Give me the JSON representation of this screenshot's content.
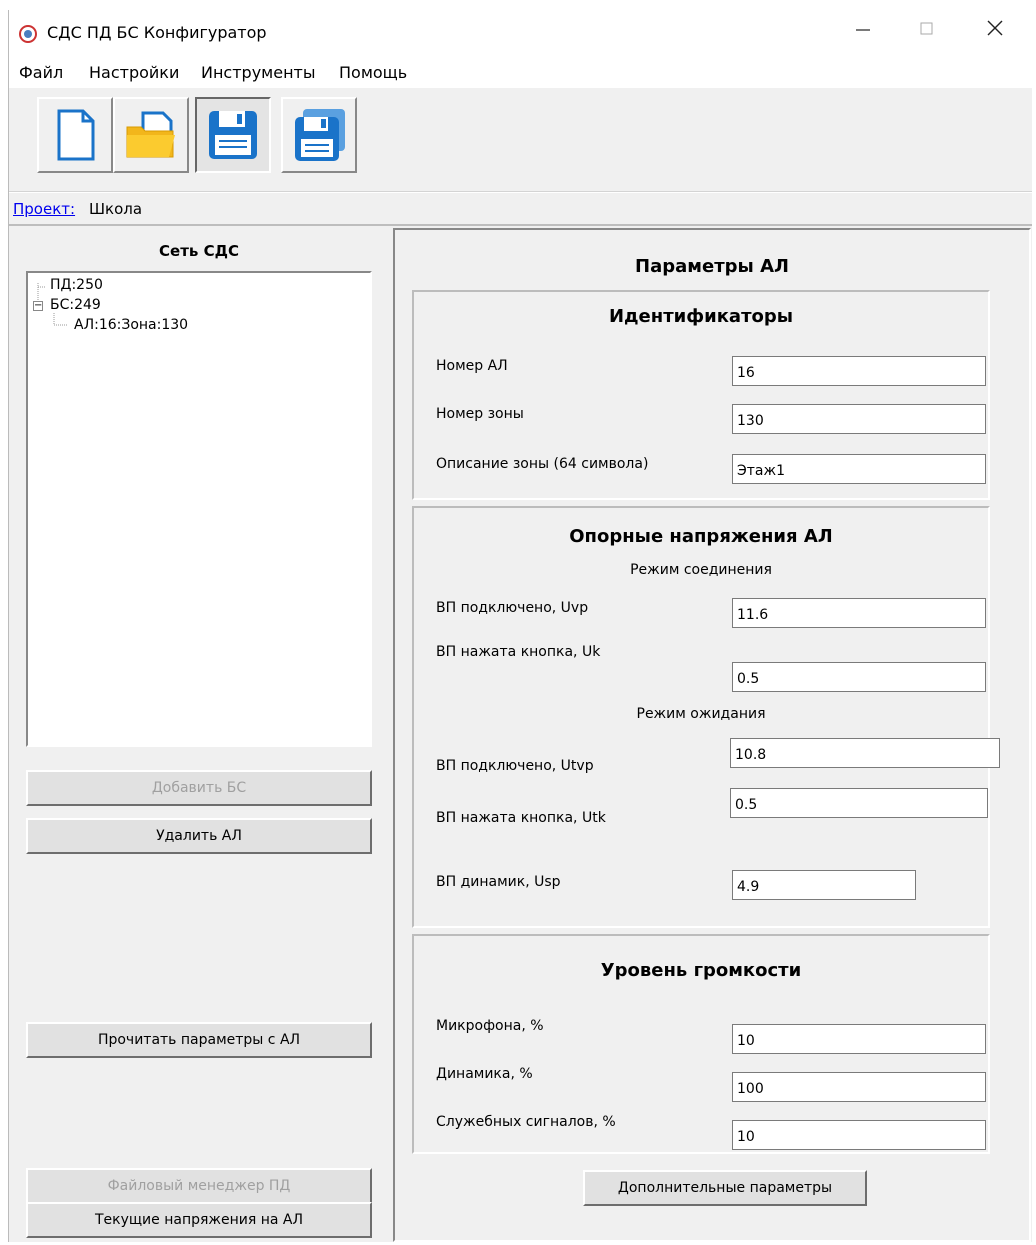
{
  "window": {
    "title": "СДС ПД БС Конфигуратор"
  },
  "menu": {
    "items": [
      "Файл",
      "Настройки",
      "Инструменты",
      "Помощь"
    ]
  },
  "project": {
    "link_label": "Проект:",
    "name": "Школа"
  },
  "left": {
    "title": "Сеть СДС",
    "tree": [
      "ПД:250",
      "БС:249",
      "АЛ:16:Зона:130"
    ],
    "buttons": {
      "add_bs": "Добавить БС",
      "delete_al": "Удалить АЛ",
      "read_params": "Прочитать параметры с АЛ",
      "file_manager": "Файловый менеджер ПД",
      "current_voltages": "Текущие напряжения на АЛ"
    }
  },
  "right": {
    "title": "Параметры АЛ",
    "identifiers": {
      "title": "Идентификаторы",
      "al_number_label": "Номер АЛ",
      "al_number": "16",
      "zone_number_label": "Номер зоны",
      "zone_number": "130",
      "zone_desc_label": "Описание зоны (64 символа)",
      "zone_desc": "Этаж1"
    },
    "voltages": {
      "title": "Опорные напряжения  АЛ",
      "connection_mode": "Режим соединения",
      "uvp_label": "ВП подключено, Uvp",
      "uvp": "11.6",
      "uk_label": "ВП нажата кнопка, Uk",
      "uk": "0.5",
      "standby_mode": "Режим ожидания",
      "utvp_label": "ВП подключено, Utvp",
      "utvp": "10.8",
      "utk_label": "ВП нажата кнопка, Utk",
      "utk": "0.5",
      "usp_label": "ВП динамик, Usp",
      "usp": "4.9"
    },
    "volume": {
      "title": "Уровень громкости",
      "mic_label": "Микрофона, %",
      "mic": "10",
      "speaker_label": "Динамика, %",
      "speaker": "100",
      "service_label": "Служебных сигналов, %",
      "service": "10"
    },
    "extra_button": "Дополнительные параметры"
  }
}
